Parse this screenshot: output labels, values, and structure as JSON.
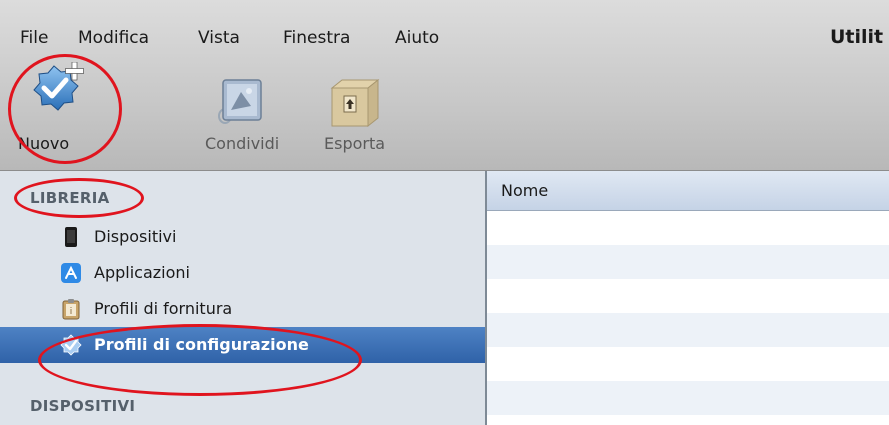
{
  "window": {
    "title": "Utilit"
  },
  "menu": {
    "items": [
      "File",
      "Modifica",
      "Vista",
      "Finestra",
      "Aiuto"
    ]
  },
  "toolbar": {
    "new_label": "Nuovo",
    "share_label": "Condividi",
    "export_label": "Esporta"
  },
  "sidebar": {
    "library_header": "LIBRERIA",
    "items": [
      {
        "label": "Dispositivi",
        "icon": "device-icon"
      },
      {
        "label": "Applicazioni",
        "icon": "app-store-icon"
      },
      {
        "label": "Profili di fornitura",
        "icon": "provisioning-profile-icon"
      },
      {
        "label": "Profili di configurazione",
        "icon": "configuration-profile-icon",
        "selected": true
      }
    ],
    "devices_header": "DISPOSITIVI"
  },
  "main": {
    "column_header": "Nome"
  },
  "colors": {
    "annotation": "#e0141e",
    "selection": "#2f62a8"
  }
}
